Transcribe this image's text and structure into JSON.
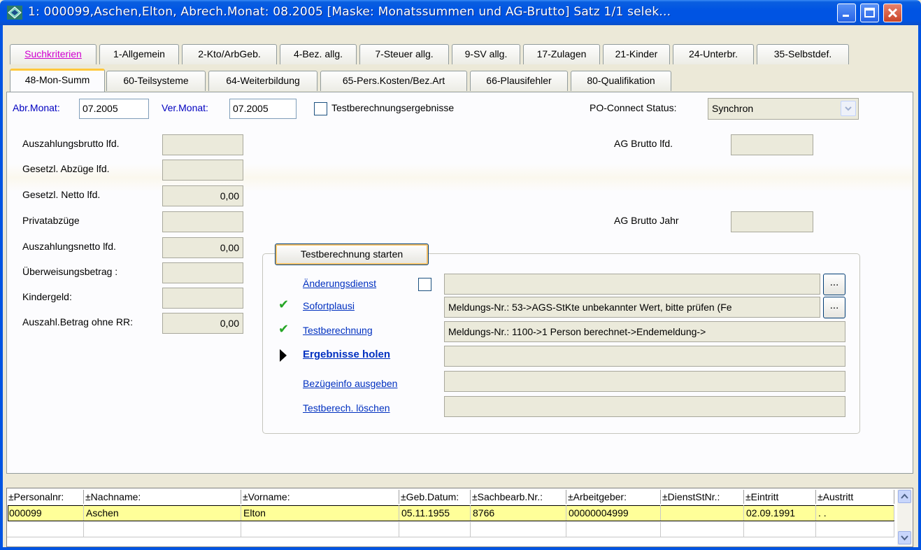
{
  "window": {
    "title": "1: 000099,Aschen,Elton, Abrech.Monat: 08.2005  [Maske: Monatssummen und AG-Brutto]   Satz 1/1 selek...",
    "icon": "app-diamond-icon",
    "accent": "#0054e3"
  },
  "tabs_row1": [
    "Suchkriterien",
    "1-Allgemein",
    "2-Kto/ArbGeb.",
    "4-Bez. allg.",
    "7-Steuer allg.",
    "9-SV allg.",
    "17-Zulagen",
    "21-Kinder",
    "24-Unterbr.",
    "35-Selbstdef."
  ],
  "tabs_row2": [
    "48-Mon-Summ",
    "60-Teilsysteme",
    "64-Weiterbildung",
    "65-Pers.Kosten/Bez.Art",
    "66-Plausifehler",
    "80-Qualifikation"
  ],
  "header": {
    "abr_label": "Abr.Monat:",
    "abr_value": "07.2005",
    "ver_label": "Ver.Monat:",
    "ver_value": "07.2005",
    "test_results_label": "Testberechnungsergebnisse",
    "po_label": "PO-Connect Status:",
    "po_value": "Synchron"
  },
  "fields": [
    {
      "label": "Auszahlungsbrutto lfd.",
      "value": ""
    },
    {
      "label": "Gesetzl. Abzüge lfd.",
      "value": ""
    },
    {
      "label": "Gesetzl. Netto lfd.",
      "value": "0,00"
    },
    {
      "label": "Privatabzüge",
      "value": ""
    },
    {
      "label": "Auszahlungsnetto lfd.",
      "value": "0,00"
    },
    {
      "label": "Überweisungsbetrag :",
      "value": ""
    },
    {
      "label": "Kindergeld:",
      "value": ""
    },
    {
      "label": "Auszahl.Betrag ohne RR:",
      "value": "0,00"
    }
  ],
  "ag": {
    "brutto_lfd_label": "AG Brutto lfd.",
    "brutto_lfd_value": "",
    "brutto_jahr_label": "AG Brutto Jahr",
    "brutto_jahr_value": ""
  },
  "test": {
    "start_button": "Testberechnung starten",
    "steps": [
      {
        "label": "Änderungsdienst",
        "status": "",
        "message": ""
      },
      {
        "label": "Sofortplausi",
        "status": "done",
        "message": "Meldungs-Nr.: 53->AGS-StKte unbekannter Wert, bitte prüfen (Fe"
      },
      {
        "label": "Testberechnung",
        "status": "done",
        "message": "Meldungs-Nr.: 1100->1 Person berechnet->Endemeldung->"
      },
      {
        "label": "Ergebnisse holen",
        "status": "current",
        "message": ""
      },
      {
        "label": "Bezügeinfo ausgeben",
        "status": "",
        "message": ""
      },
      {
        "label": "Testberech. löschen",
        "status": "",
        "message": ""
      }
    ],
    "ellipsis": "..."
  },
  "grid": {
    "columns": [
      "±Personalnr:",
      "±Nachname:",
      "±Vorname:",
      "±Geb.Datum:",
      "±Sachbearb.Nr.:",
      "±Arbeitgeber:",
      "±DienstStNr.:",
      "±Eintritt",
      "±Austritt"
    ],
    "rows": [
      [
        "000099",
        "Aschen",
        "Elton",
        "05.11.1955",
        "8766",
        "00000004999",
        "",
        "02.09.1991",
        ". ."
      ]
    ]
  }
}
